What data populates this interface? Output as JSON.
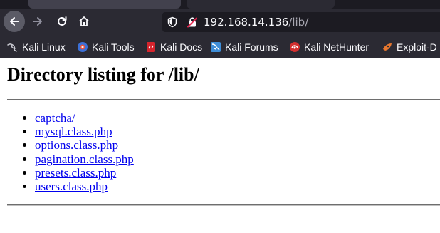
{
  "browser": {
    "address": {
      "host": "192.168.14.136",
      "path": "/lib/"
    },
    "bookmarks": [
      {
        "label": "Kali Linux",
        "icon": "kali-dragon-icon"
      },
      {
        "label": "Kali Tools",
        "icon": "kali-tools-icon"
      },
      {
        "label": "Kali Docs",
        "icon": "kali-docs-icon"
      },
      {
        "label": "Kali Forums",
        "icon": "kali-forums-icon"
      },
      {
        "label": "Kali NetHunter",
        "icon": "nethunter-icon"
      },
      {
        "label": "Exploit-D",
        "icon": "exploit-db-icon"
      }
    ]
  },
  "page": {
    "title": "Directory listing for /lib/",
    "files": [
      "captcha/",
      "mysql.class.php",
      "options.class.php",
      "pagination.class.php",
      "presets.class.php",
      "users.class.php"
    ]
  }
}
